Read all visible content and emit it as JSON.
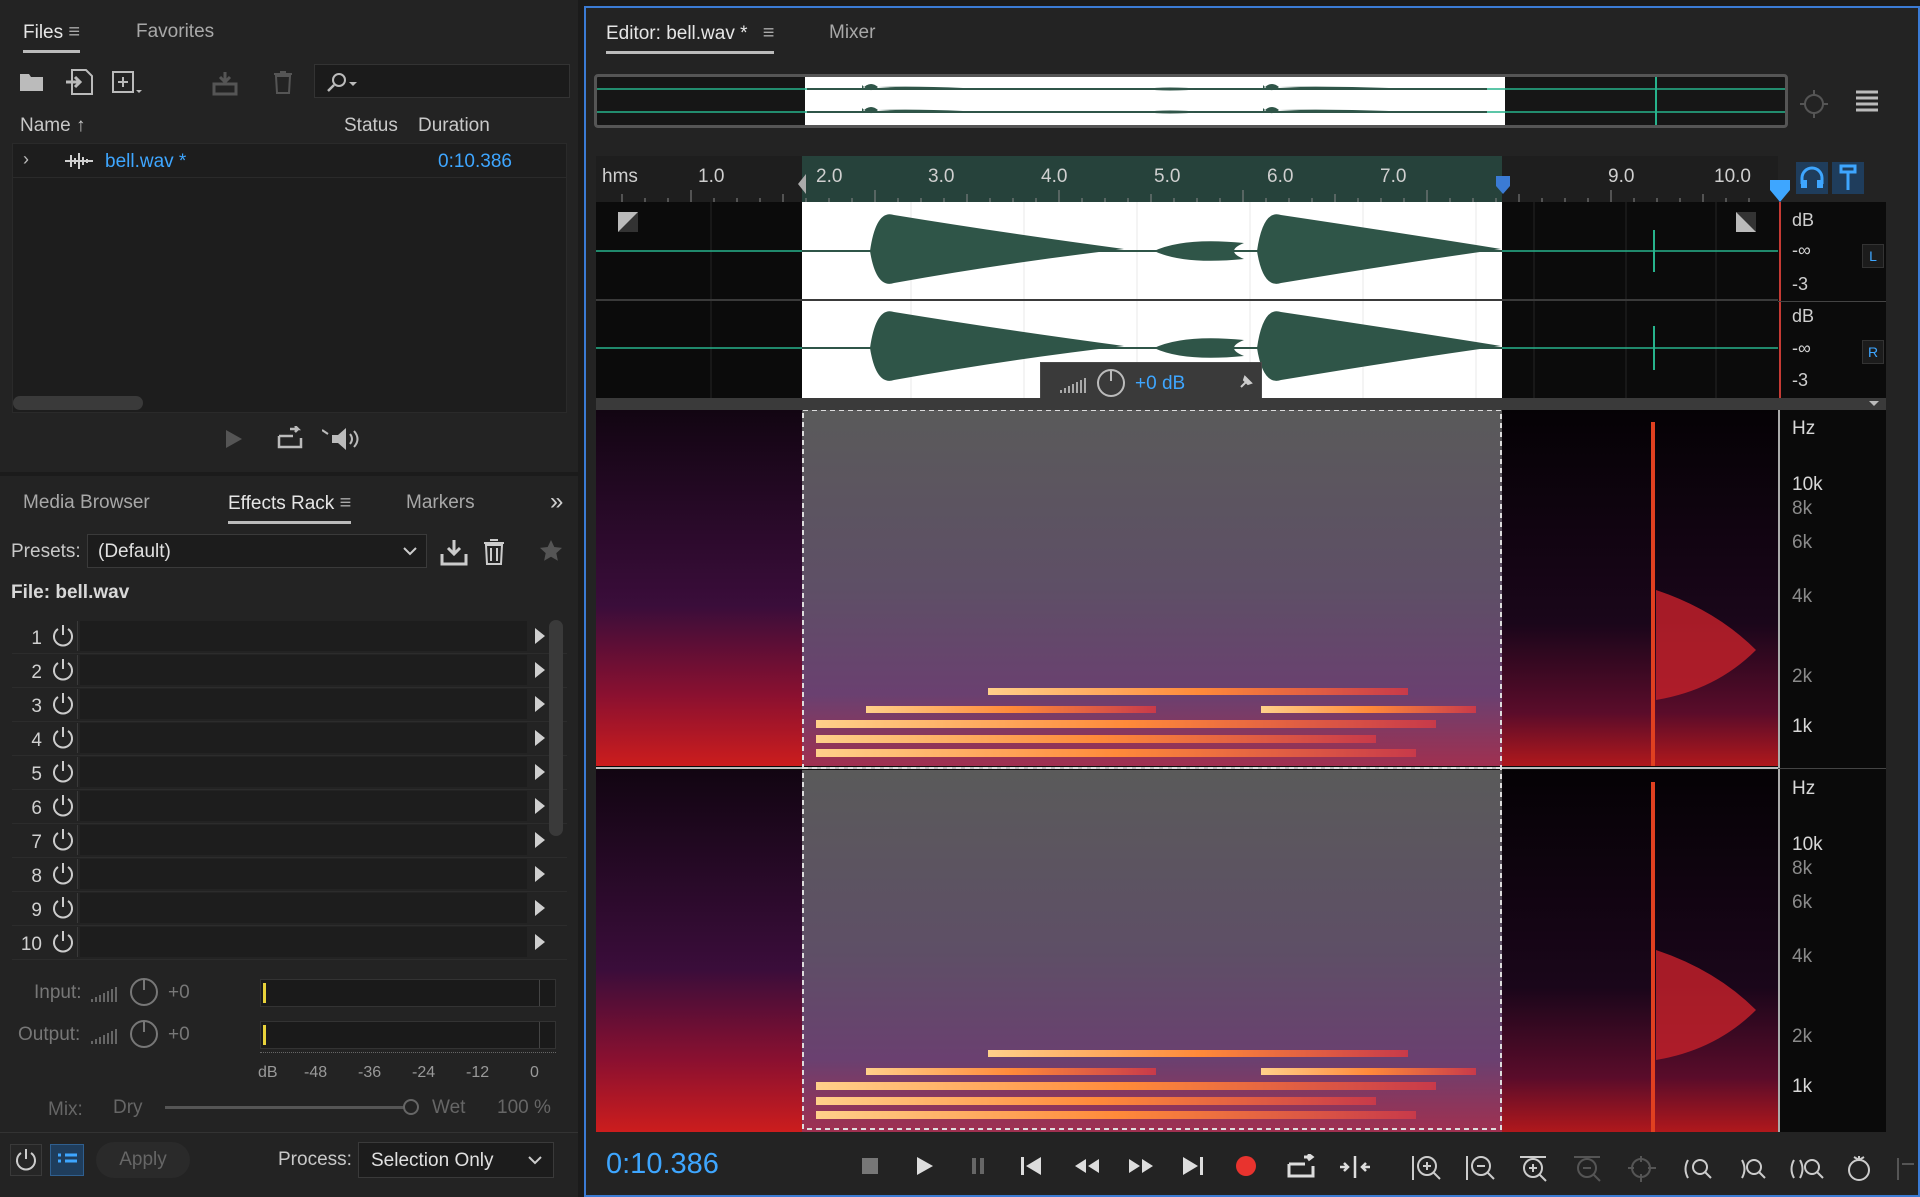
{
  "files_panel": {
    "tabs": [
      "Files",
      "Favorites"
    ],
    "columns": {
      "name": "Name",
      "status": "Status",
      "duration": "Duration"
    },
    "file": {
      "name": "bell.wav *",
      "duration": "0:10.386"
    }
  },
  "effects_panel": {
    "tabs": [
      "Media Browser",
      "Effects Rack",
      "Markers"
    ],
    "presets_label": "Presets:",
    "preset_value": "(Default)",
    "file_label": "File: bell.wav",
    "slots": [
      "1",
      "2",
      "3",
      "4",
      "5",
      "6",
      "7",
      "8",
      "9",
      "10"
    ],
    "input_label": "Input:",
    "input_value": "+0",
    "output_label": "Output:",
    "output_value": "+0",
    "meter_scale": [
      "dB",
      "-48",
      "-36",
      "-24",
      "-12",
      "0"
    ],
    "mix_label": "Mix:",
    "mix_dry": "Dry",
    "mix_wet": "Wet",
    "mix_value": "100 %",
    "apply_label": "Apply",
    "process_label": "Process:",
    "process_value": "Selection Only"
  },
  "editor": {
    "tabs": [
      "Editor: bell.wav *",
      "Mixer"
    ],
    "ruler_unit": "hms",
    "ruler_ticks": [
      "1.0",
      "2.0",
      "3.0",
      "4.0",
      "5.0",
      "6.0",
      "7.0",
      "9.0",
      "10.0"
    ],
    "db_labels": [
      "dB",
      "-∞",
      "-3",
      "dB",
      "-∞",
      "-3"
    ],
    "channels": [
      "L",
      "R"
    ],
    "hud_gain": "+0 dB",
    "hz_labels": [
      "Hz",
      "10k",
      "8k",
      "6k",
      "4k",
      "2k",
      "1k"
    ],
    "time_display": "0:10.386"
  },
  "colors": {
    "accent": "#3ea6ff",
    "waveform": "#2f5548",
    "record": "#e8332e",
    "play_head": "#e0312f"
  }
}
